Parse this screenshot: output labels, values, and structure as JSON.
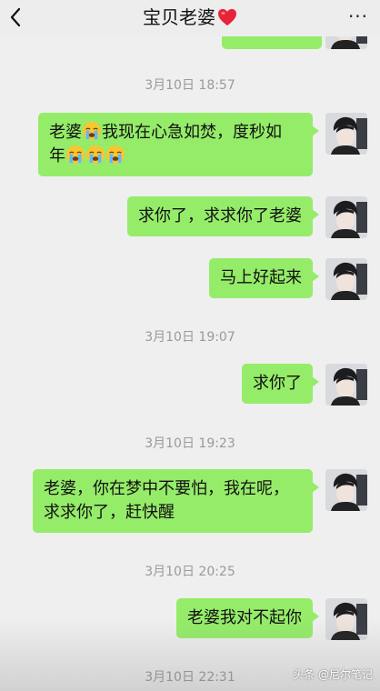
{
  "header": {
    "title": "宝贝老婆",
    "back_icon": "chevron-left-icon",
    "heart_icon": "red-heart-icon",
    "more_label": "···"
  },
  "messages": [
    {
      "type": "time",
      "text": "3月10日 18:57"
    },
    {
      "type": "sent",
      "line1_prefix": "老婆",
      "line1_suffix": "我现在心急如焚，度秒如",
      "line2_prefix": "年"
    },
    {
      "type": "sent",
      "text": "求你了，求求你了老婆"
    },
    {
      "type": "sent",
      "text": "马上好起来"
    },
    {
      "type": "time",
      "text": "3月10日 19:07"
    },
    {
      "type": "sent",
      "text": "求你了"
    },
    {
      "type": "time",
      "text": "3月10日 19:23"
    },
    {
      "type": "sent",
      "line1": "老婆，你在梦中不要怕，我在呢，",
      "line2": "求求你了，赶快醒"
    },
    {
      "type": "time",
      "text": "3月10日 20:25"
    },
    {
      "type": "sent",
      "text": "老婆我对不起你"
    },
    {
      "type": "time",
      "text": "3月10日 22:31"
    }
  ],
  "colors": {
    "sent_bubble": "#95ec69",
    "background": "#efefef",
    "timestamp": "#9a9a9a"
  },
  "watermark": "头条 @尼尔笔记"
}
